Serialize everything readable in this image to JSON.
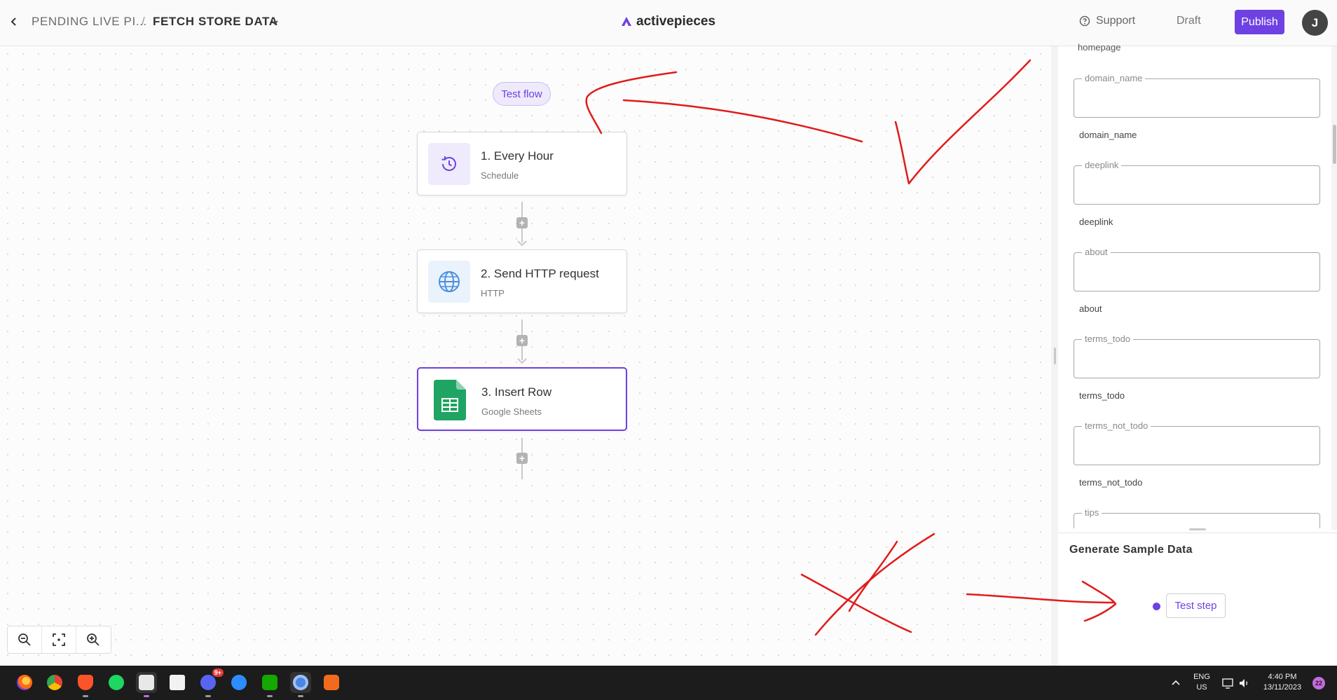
{
  "header": {
    "breadcrumb_folder": "PENDING LIVE PI...",
    "breadcrumb_sep": "/",
    "breadcrumb_flow": "FETCH STORE DATA",
    "logo_text": "activepieces",
    "support_label": "Support",
    "status_label": "Draft",
    "publish_label": "Publish",
    "avatar_initial": "J"
  },
  "canvas": {
    "test_flow_label": "Test flow",
    "steps": [
      {
        "title": "1. Every Hour",
        "subtitle": "Schedule",
        "icon": "clock-icon"
      },
      {
        "title": "2. Send HTTP request",
        "subtitle": "HTTP",
        "icon": "globe-icon"
      },
      {
        "title": "3. Insert Row",
        "subtitle": "Google Sheets",
        "icon": "google-sheets-icon"
      }
    ],
    "add_step_symbol": "+"
  },
  "panel": {
    "cut_label": "homepage",
    "fields": [
      {
        "legend": "domain_name",
        "label": "domain_name",
        "value": ""
      },
      {
        "legend": "deeplink",
        "label": "deeplink",
        "value": ""
      },
      {
        "legend": "about",
        "label": "about",
        "value": ""
      },
      {
        "legend": "terms_todo",
        "label": "terms_todo",
        "value": ""
      },
      {
        "legend": "terms_not_todo",
        "label": "terms_not_todo",
        "value": ""
      },
      {
        "legend": "tips",
        "label": "",
        "value": ""
      }
    ],
    "generate_title": "Generate Sample Data",
    "test_step_label": "Test step"
  },
  "taskbar": {
    "discord_badge": "9+",
    "lang_line1": "ENG",
    "lang_line2": "US",
    "time": "4:40 PM",
    "date": "13/11/2023",
    "notifications": "22"
  },
  "colors": {
    "accent": "#6e41e2",
    "annotation": "#e01b1b",
    "sheets_green": "#1fa463"
  }
}
